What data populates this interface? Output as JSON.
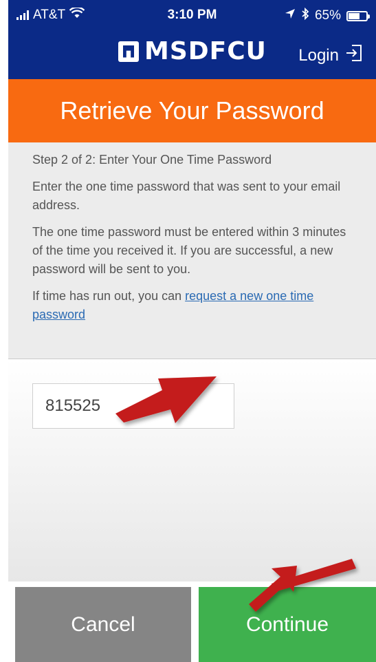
{
  "status_bar": {
    "carrier": "AT&T",
    "time": "3:10 PM",
    "battery": "65%",
    "battery_level": 0.65
  },
  "header": {
    "logo_text": "MSDFCU",
    "login_label": "Login"
  },
  "page_title": "Retrieve Your Password",
  "instructions": {
    "step": "Step 2 of 2: Enter Your One Time Password",
    "paragraph1": "Enter the one time password that was sent to your email address.",
    "paragraph2": "The one time password must be entered within 3 minutes of the time you received it. If you are successful, a new password will be sent to you.",
    "paragraph3_prefix": "If time has run out, you can ",
    "paragraph3_link": "request a new one time password"
  },
  "otp_field": {
    "value": "815525"
  },
  "buttons": {
    "cancel": "Cancel",
    "continue": "Continue"
  },
  "colors": {
    "header": "#0b2a87",
    "title_bar": "#f86a11",
    "cancel": "#858585",
    "continue": "#3fb14e",
    "annotation_arrow": "#c41a1a",
    "link": "#2a6ab3"
  }
}
